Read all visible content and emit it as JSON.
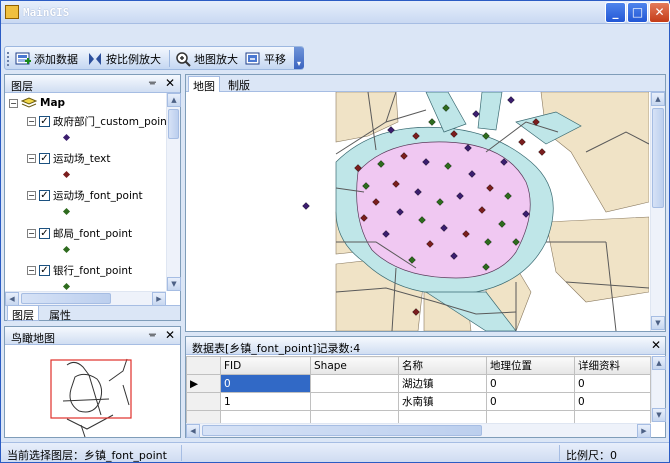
{
  "window": {
    "title": "MainGIS",
    "minimize_label": "_",
    "maximize_label": "□",
    "close_label": "✕"
  },
  "toolbar": {
    "add_data_label": "添加数据",
    "scale_zoom_label": "按比例放大",
    "map_zoom_label": "地图放大",
    "pan_label": "平移",
    "overflow_label": "▾"
  },
  "layers_panel": {
    "title": "图层",
    "pin_label": "ᚚ",
    "close_label": "✕",
    "root_label": "Map",
    "layers": [
      {
        "label": "政府部门_custom_point",
        "symbol_color": "#3b1e6e"
      },
      {
        "label": "运动场_text",
        "symbol_color": "#7a1e1e"
      },
      {
        "label": "运动场_font_point",
        "symbol_color": "#2e6b1e"
      },
      {
        "label": "邮局_font_point",
        "symbol_color": "#2e6b1e"
      },
      {
        "label": "银行_font_point",
        "symbol_color": "#2e6b1e"
      }
    ],
    "tabs": [
      "图层",
      "属性"
    ]
  },
  "overview_panel": {
    "title": "鸟瞰地图",
    "pin_label": "ᚚ",
    "close_label": "✕"
  },
  "map_view": {
    "tabs": [
      "地图",
      "制版"
    ],
    "colors": {
      "city": "#f0c8f2",
      "river": "#bfe6e8",
      "land": "#f0e3c6",
      "road": "#5a5a5a"
    }
  },
  "attribute_table": {
    "title": "数据表[乡镇_font_point]记录数:4",
    "close_label": "✕",
    "columns": [
      "FID",
      "Shape",
      "名称",
      "地理位置",
      "详细资料"
    ],
    "rows": [
      [
        "0",
        "",
        "湖边镇",
        "0",
        "0"
      ],
      [
        "1",
        "",
        "水南镇",
        "0",
        "0"
      ],
      [
        "",
        "",
        "",
        "",
        ""
      ]
    ]
  },
  "statusbar": {
    "current_layer": "当前选择图层：乡镇_font_point",
    "scale": "比例尺：0"
  }
}
